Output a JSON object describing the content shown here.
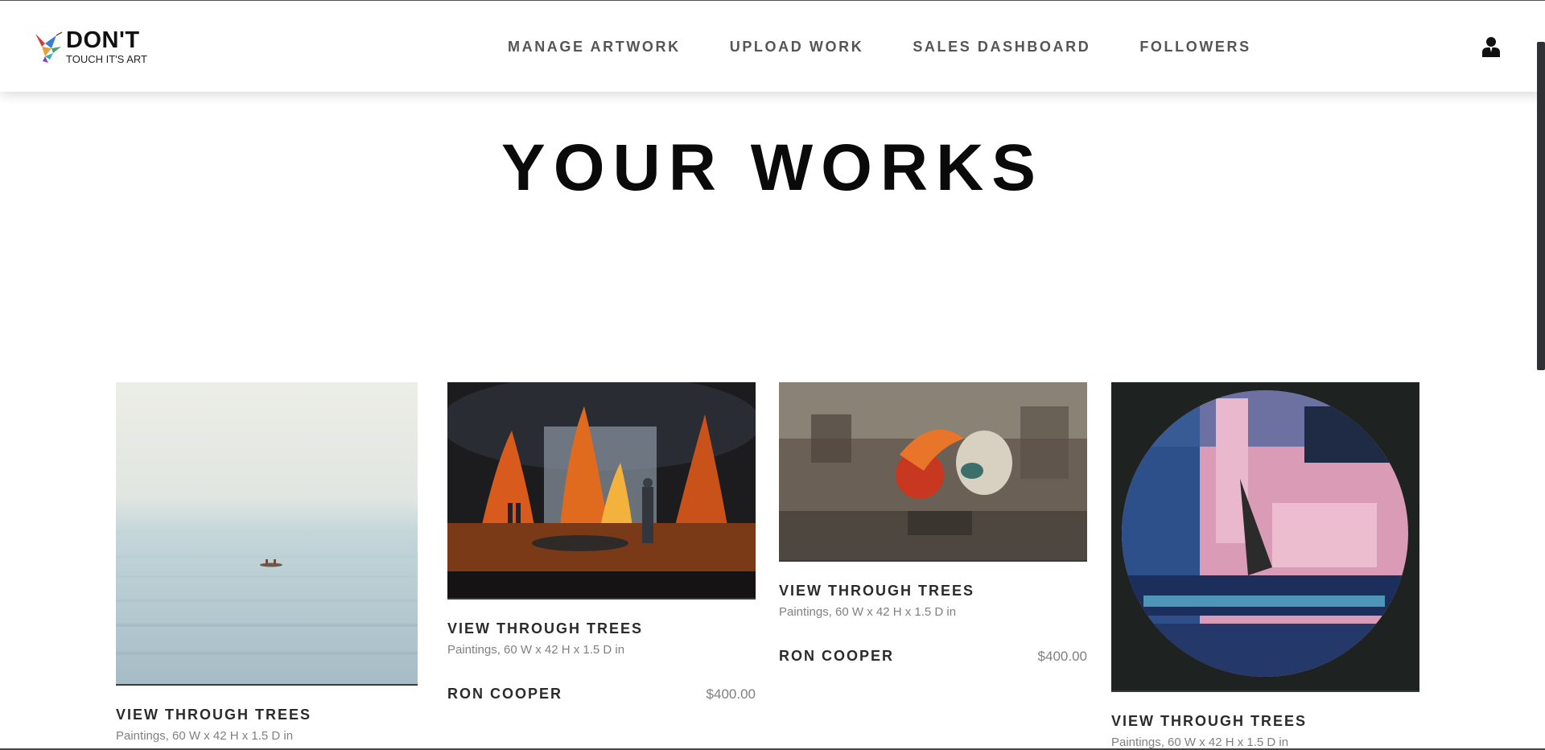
{
  "brand": {
    "title": "DON'T",
    "subtitle": "TOUCH IT'S ART"
  },
  "nav": [
    {
      "label": "MANAGE ARTWORK"
    },
    {
      "label": "UPLOAD WORK"
    },
    {
      "label": "SALES DASHBOARD"
    },
    {
      "label": "FOLLOWERS"
    }
  ],
  "icons": {
    "account": "user-icon",
    "logo": "hummingbird-logo-icon"
  },
  "page": {
    "title": "YOUR WORKS"
  },
  "works": [
    {
      "title": "VIEW THROUGH TREES",
      "meta": "Paintings, 60 W x 42 H x 1.5 D in",
      "artist": "",
      "price": ""
    },
    {
      "title": "VIEW THROUGH TREES",
      "meta": "Paintings, 60 W x 42 H x 1.5 D in",
      "artist": "RON COOPER",
      "price": "$400.00"
    },
    {
      "title": "VIEW THROUGH TREES",
      "meta": "Paintings, 60 W x 42 H x 1.5 D in",
      "artist": "RON COOPER",
      "price": "$400.00"
    },
    {
      "title": "VIEW THROUGH TREES",
      "meta": "Paintings, 60 W x 42 H x 1.5 D in",
      "artist": "",
      "price": ""
    }
  ],
  "colors": {
    "nav_text": "#555555",
    "muted_text": "#808080",
    "heading": "#0a0a0a"
  }
}
